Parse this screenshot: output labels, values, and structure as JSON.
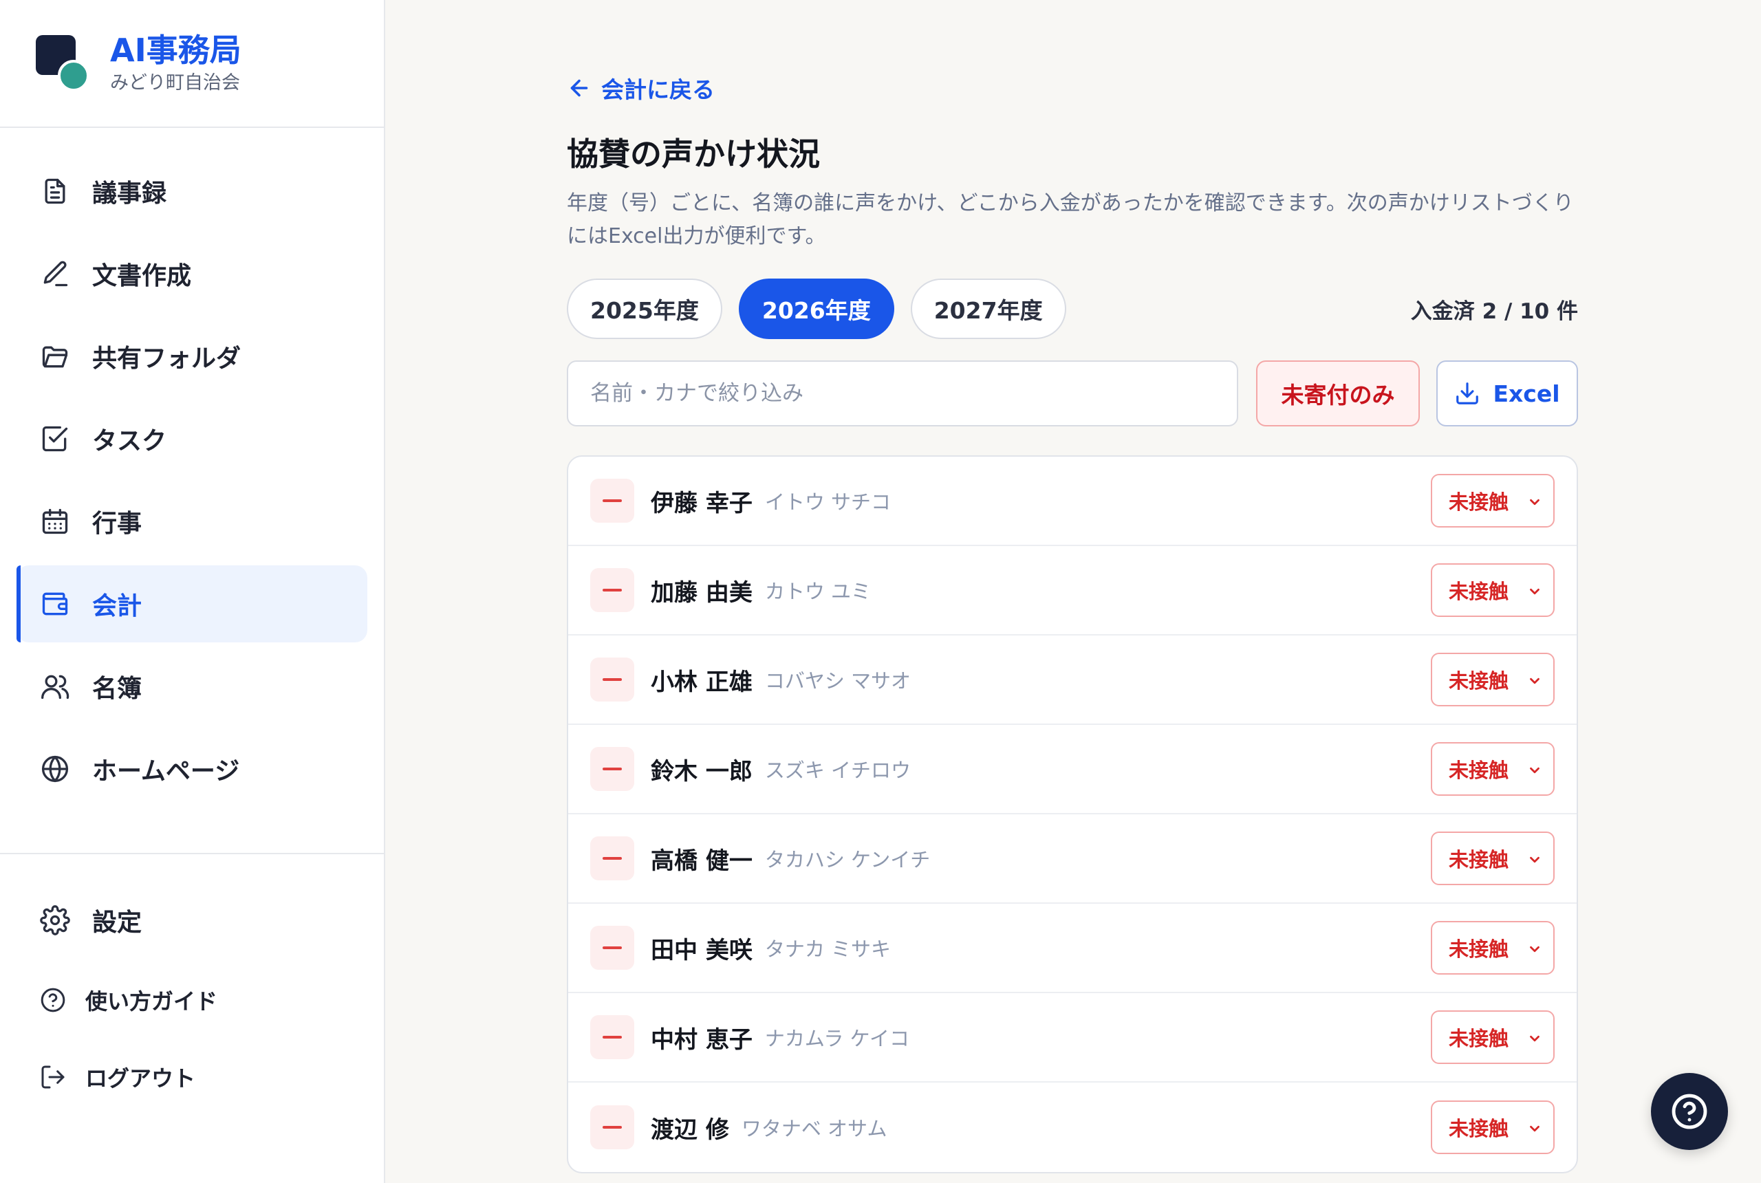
{
  "brand": {
    "title": "AI事務局",
    "subtitle": "みどり町自治会"
  },
  "nav": {
    "items": [
      {
        "label": "議事録",
        "icon": "document-icon"
      },
      {
        "label": "文書作成",
        "icon": "pen-icon"
      },
      {
        "label": "共有フォルダ",
        "icon": "folder-icon"
      },
      {
        "label": "タスク",
        "icon": "checkbox-icon"
      },
      {
        "label": "行事",
        "icon": "calendar-icon"
      },
      {
        "label": "会計",
        "icon": "wallet-icon",
        "active": true
      },
      {
        "label": "名簿",
        "icon": "users-icon"
      },
      {
        "label": "ホームページ",
        "icon": "globe-icon"
      }
    ],
    "bottom": [
      {
        "label": "設定",
        "icon": "gear-icon"
      },
      {
        "label": "使い方ガイド",
        "icon": "help-circle-icon"
      },
      {
        "label": "ログアウト",
        "icon": "logout-icon"
      }
    ]
  },
  "main": {
    "back_label": "会計に戻る",
    "title": "協賛の声かけ状況",
    "description": "年度（号）ごとに、名簿の誰に声をかけ、どこから入金があったかを確認できます。次の声かけリストづくりにはExcel出力が便利です。",
    "years": [
      {
        "label": "2025年度",
        "active": false
      },
      {
        "label": "2026年度",
        "active": true
      },
      {
        "label": "2027年度",
        "active": false
      }
    ],
    "count_text": "入金済 2 / 10 件",
    "search_placeholder": "名前・カナで絞り込み",
    "unpaid_filter_label": "未寄付のみ",
    "excel_label": "Excel",
    "rows": [
      {
        "name": "伊藤 幸子",
        "kana": "イトウ サチコ",
        "status": "未接触"
      },
      {
        "name": "加藤 由美",
        "kana": "カトウ ユミ",
        "status": "未接触"
      },
      {
        "name": "小林 正雄",
        "kana": "コバヤシ マサオ",
        "status": "未接触"
      },
      {
        "name": "鈴木 一郎",
        "kana": "スズキ イチロウ",
        "status": "未接触"
      },
      {
        "name": "高橋 健一",
        "kana": "タカハシ ケンイチ",
        "status": "未接触"
      },
      {
        "name": "田中 美咲",
        "kana": "タナカ ミサキ",
        "status": "未接触"
      },
      {
        "name": "中村 恵子",
        "kana": "ナカムラ ケイコ",
        "status": "未接触"
      },
      {
        "name": "渡辺 修",
        "kana": "ワタナベ オサム",
        "status": "未接触"
      }
    ]
  },
  "colors": {
    "accent": "#1a56e8",
    "brand_dark": "#17203a",
    "brand_teal": "#2f9e8f",
    "danger": "#d62626"
  }
}
